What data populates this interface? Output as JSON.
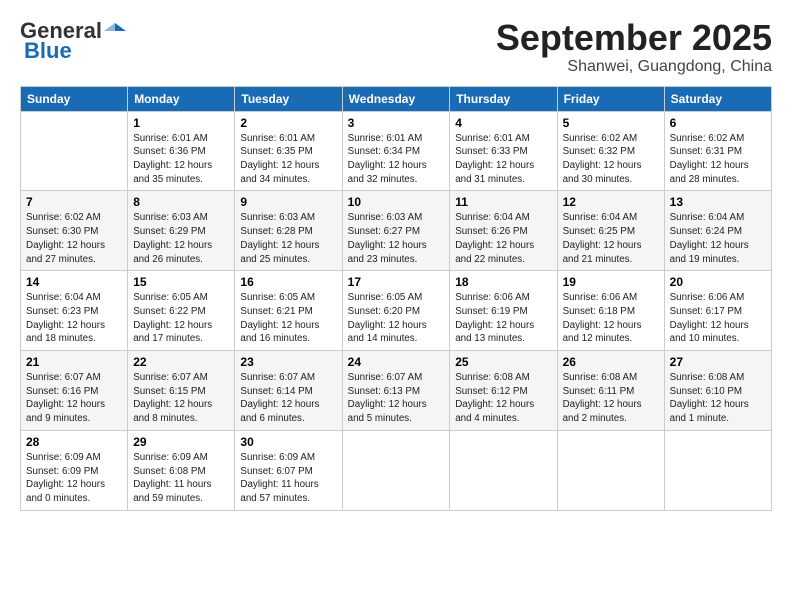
{
  "logo": {
    "line1": "General",
    "line2": "Blue"
  },
  "title": "September 2025",
  "location": "Shanwei, Guangdong, China",
  "headers": [
    "Sunday",
    "Monday",
    "Tuesday",
    "Wednesday",
    "Thursday",
    "Friday",
    "Saturday"
  ],
  "weeks": [
    [
      {
        "day": "",
        "info": ""
      },
      {
        "day": "1",
        "info": "Sunrise: 6:01 AM\nSunset: 6:36 PM\nDaylight: 12 hours\nand 35 minutes."
      },
      {
        "day": "2",
        "info": "Sunrise: 6:01 AM\nSunset: 6:35 PM\nDaylight: 12 hours\nand 34 minutes."
      },
      {
        "day": "3",
        "info": "Sunrise: 6:01 AM\nSunset: 6:34 PM\nDaylight: 12 hours\nand 32 minutes."
      },
      {
        "day": "4",
        "info": "Sunrise: 6:01 AM\nSunset: 6:33 PM\nDaylight: 12 hours\nand 31 minutes."
      },
      {
        "day": "5",
        "info": "Sunrise: 6:02 AM\nSunset: 6:32 PM\nDaylight: 12 hours\nand 30 minutes."
      },
      {
        "day": "6",
        "info": "Sunrise: 6:02 AM\nSunset: 6:31 PM\nDaylight: 12 hours\nand 28 minutes."
      }
    ],
    [
      {
        "day": "7",
        "info": "Sunrise: 6:02 AM\nSunset: 6:30 PM\nDaylight: 12 hours\nand 27 minutes."
      },
      {
        "day": "8",
        "info": "Sunrise: 6:03 AM\nSunset: 6:29 PM\nDaylight: 12 hours\nand 26 minutes."
      },
      {
        "day": "9",
        "info": "Sunrise: 6:03 AM\nSunset: 6:28 PM\nDaylight: 12 hours\nand 25 minutes."
      },
      {
        "day": "10",
        "info": "Sunrise: 6:03 AM\nSunset: 6:27 PM\nDaylight: 12 hours\nand 23 minutes."
      },
      {
        "day": "11",
        "info": "Sunrise: 6:04 AM\nSunset: 6:26 PM\nDaylight: 12 hours\nand 22 minutes."
      },
      {
        "day": "12",
        "info": "Sunrise: 6:04 AM\nSunset: 6:25 PM\nDaylight: 12 hours\nand 21 minutes."
      },
      {
        "day": "13",
        "info": "Sunrise: 6:04 AM\nSunset: 6:24 PM\nDaylight: 12 hours\nand 19 minutes."
      }
    ],
    [
      {
        "day": "14",
        "info": "Sunrise: 6:04 AM\nSunset: 6:23 PM\nDaylight: 12 hours\nand 18 minutes."
      },
      {
        "day": "15",
        "info": "Sunrise: 6:05 AM\nSunset: 6:22 PM\nDaylight: 12 hours\nand 17 minutes."
      },
      {
        "day": "16",
        "info": "Sunrise: 6:05 AM\nSunset: 6:21 PM\nDaylight: 12 hours\nand 16 minutes."
      },
      {
        "day": "17",
        "info": "Sunrise: 6:05 AM\nSunset: 6:20 PM\nDaylight: 12 hours\nand 14 minutes."
      },
      {
        "day": "18",
        "info": "Sunrise: 6:06 AM\nSunset: 6:19 PM\nDaylight: 12 hours\nand 13 minutes."
      },
      {
        "day": "19",
        "info": "Sunrise: 6:06 AM\nSunset: 6:18 PM\nDaylight: 12 hours\nand 12 minutes."
      },
      {
        "day": "20",
        "info": "Sunrise: 6:06 AM\nSunset: 6:17 PM\nDaylight: 12 hours\nand 10 minutes."
      }
    ],
    [
      {
        "day": "21",
        "info": "Sunrise: 6:07 AM\nSunset: 6:16 PM\nDaylight: 12 hours\nand 9 minutes."
      },
      {
        "day": "22",
        "info": "Sunrise: 6:07 AM\nSunset: 6:15 PM\nDaylight: 12 hours\nand 8 minutes."
      },
      {
        "day": "23",
        "info": "Sunrise: 6:07 AM\nSunset: 6:14 PM\nDaylight: 12 hours\nand 6 minutes."
      },
      {
        "day": "24",
        "info": "Sunrise: 6:07 AM\nSunset: 6:13 PM\nDaylight: 12 hours\nand 5 minutes."
      },
      {
        "day": "25",
        "info": "Sunrise: 6:08 AM\nSunset: 6:12 PM\nDaylight: 12 hours\nand 4 minutes."
      },
      {
        "day": "26",
        "info": "Sunrise: 6:08 AM\nSunset: 6:11 PM\nDaylight: 12 hours\nand 2 minutes."
      },
      {
        "day": "27",
        "info": "Sunrise: 6:08 AM\nSunset: 6:10 PM\nDaylight: 12 hours\nand 1 minute."
      }
    ],
    [
      {
        "day": "28",
        "info": "Sunrise: 6:09 AM\nSunset: 6:09 PM\nDaylight: 12 hours\nand 0 minutes."
      },
      {
        "day": "29",
        "info": "Sunrise: 6:09 AM\nSunset: 6:08 PM\nDaylight: 11 hours\nand 59 minutes."
      },
      {
        "day": "30",
        "info": "Sunrise: 6:09 AM\nSunset: 6:07 PM\nDaylight: 11 hours\nand 57 minutes."
      },
      {
        "day": "",
        "info": ""
      },
      {
        "day": "",
        "info": ""
      },
      {
        "day": "",
        "info": ""
      },
      {
        "day": "",
        "info": ""
      }
    ]
  ]
}
